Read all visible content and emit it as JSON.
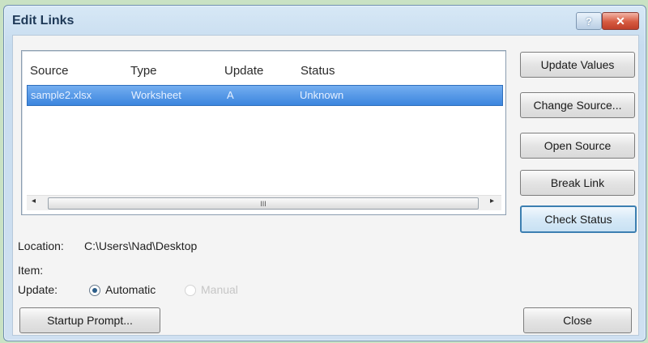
{
  "window": {
    "title": "Edit Links",
    "help_label": "?",
    "close_label": "✕"
  },
  "list": {
    "columns": [
      "Source",
      "Type",
      "Update",
      "Status"
    ],
    "rows": [
      {
        "source": "sample2.xlsx",
        "type": "Worksheet",
        "update": "A",
        "status": "Unknown"
      }
    ],
    "scroll_left": "◂",
    "scroll_right": "▸",
    "scroll_thumb": "III"
  },
  "buttons": {
    "update_values": "Update Values",
    "change_source": "Change Source...",
    "open_source": "Open Source",
    "break_link": "Break Link",
    "check_status": "Check Status",
    "startup_prompt": "Startup Prompt...",
    "close": "Close"
  },
  "details": {
    "location_label": "Location:",
    "location_value": "C:\\Users\\Nad\\Desktop",
    "item_label": "Item:",
    "update_label": "Update:",
    "automatic": "Automatic",
    "manual": "Manual",
    "selected": "Automatic"
  }
}
